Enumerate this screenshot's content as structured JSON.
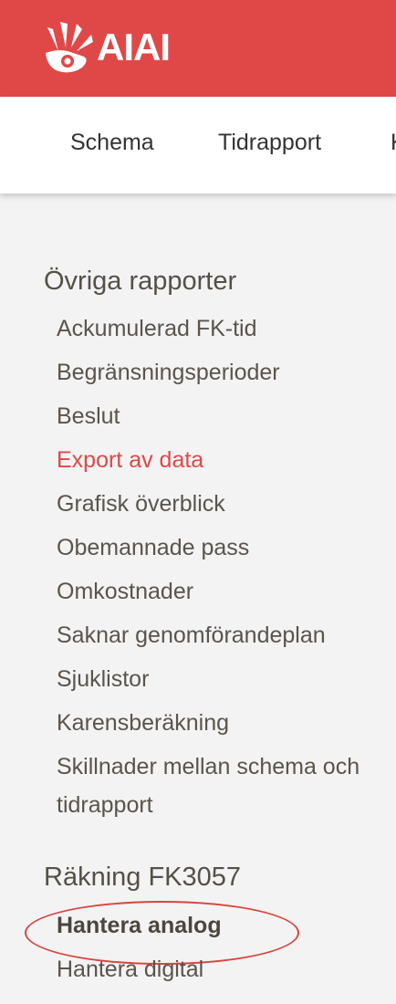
{
  "header": {
    "brand": "AIAI",
    "bg_color": "#e04848",
    "logo_icon": "hand-logo-icon"
  },
  "nav": {
    "items": [
      {
        "label": "Schema"
      },
      {
        "label": "Tidrapport"
      },
      {
        "label": "K"
      }
    ]
  },
  "sections": [
    {
      "title": "Övriga rapporter",
      "items": [
        {
          "label": "Ackumulerad FK-tid"
        },
        {
          "label": "Begränsningsperioder"
        },
        {
          "label": "Beslut"
        },
        {
          "label": "Export av data",
          "active": true
        },
        {
          "label": "Grafisk överblick"
        },
        {
          "label": "Obemannade pass"
        },
        {
          "label": "Omkostnader"
        },
        {
          "label": "Saknar genomförandeplan"
        },
        {
          "label": "Sjuklistor"
        },
        {
          "label": "Karensberäkning"
        },
        {
          "label": "Skillnader mellan schema och",
          "continuation": "tidrapport"
        }
      ]
    },
    {
      "title": "Räkning FK3057",
      "items": [
        {
          "label": "Hantera analog",
          "bold": true,
          "circled": true
        },
        {
          "label": "Hantera digital"
        }
      ]
    }
  ],
  "colors": {
    "accent": "#e04848",
    "text": "#5a544d",
    "annotation": "#d9453f"
  }
}
